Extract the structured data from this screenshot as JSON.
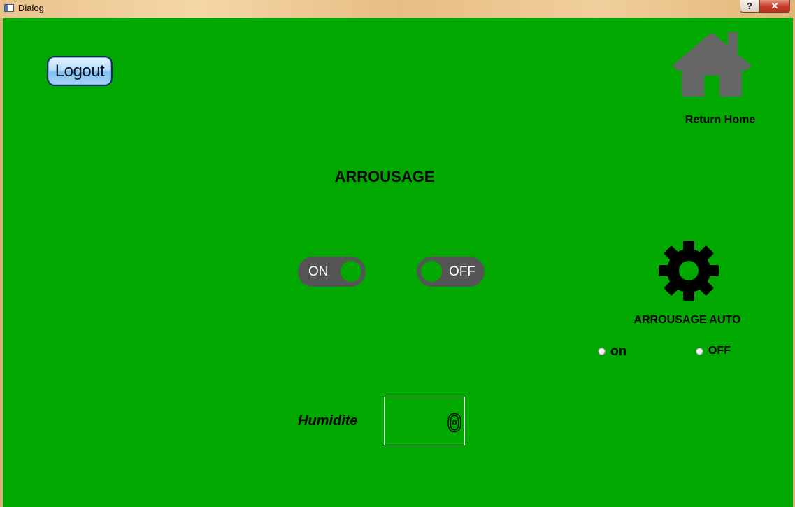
{
  "window": {
    "title": "Dialog",
    "help_glyph": "?",
    "close_glyph": "✕"
  },
  "colors": {
    "background": "#00a800",
    "toggle": "#555555",
    "home_icon": "#666666",
    "logout_blue": "#7fbff0"
  },
  "header": {
    "logout_label": "Logout",
    "home_icon": "home-icon",
    "return_home_label": "Return Home"
  },
  "main": {
    "title": "ARROUSAGE",
    "toggle_on_label": "ON",
    "toggle_off_label": "OFF"
  },
  "auto": {
    "icon": "gear-icon",
    "label": "ARROUSAGE AUTO",
    "radio_on_label": "on",
    "radio_off_label": "OFF"
  },
  "humidity": {
    "label": "Humidite",
    "value": "0"
  }
}
